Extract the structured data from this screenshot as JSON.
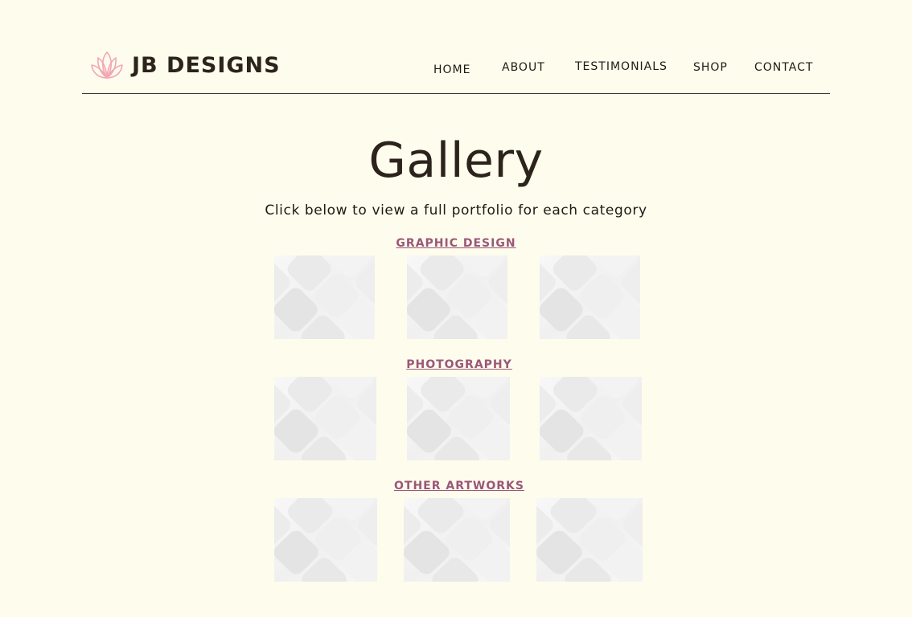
{
  "header": {
    "brand": "JB DESIGNS",
    "logo_icon": "lotus-icon",
    "nav": [
      "HOME",
      "ABOUT",
      "TESTIMONIALS",
      "SHOP",
      "CONTACT"
    ]
  },
  "main": {
    "title": "Gallery",
    "subtitle": "Click below to view a full portfolio for each category",
    "categories": [
      {
        "label": "GRAPHIC DESIGN",
        "thumb_count": 3
      },
      {
        "label": "PHOTOGRAPHY",
        "thumb_count": 3
      },
      {
        "label": "OTHER ARTWORKS",
        "thumb_count": 3
      }
    ]
  },
  "colors": {
    "background": "#fefcec",
    "text": "#2b231c",
    "category_link": "#9a577a",
    "logo_pink": "#f2a6b6"
  }
}
